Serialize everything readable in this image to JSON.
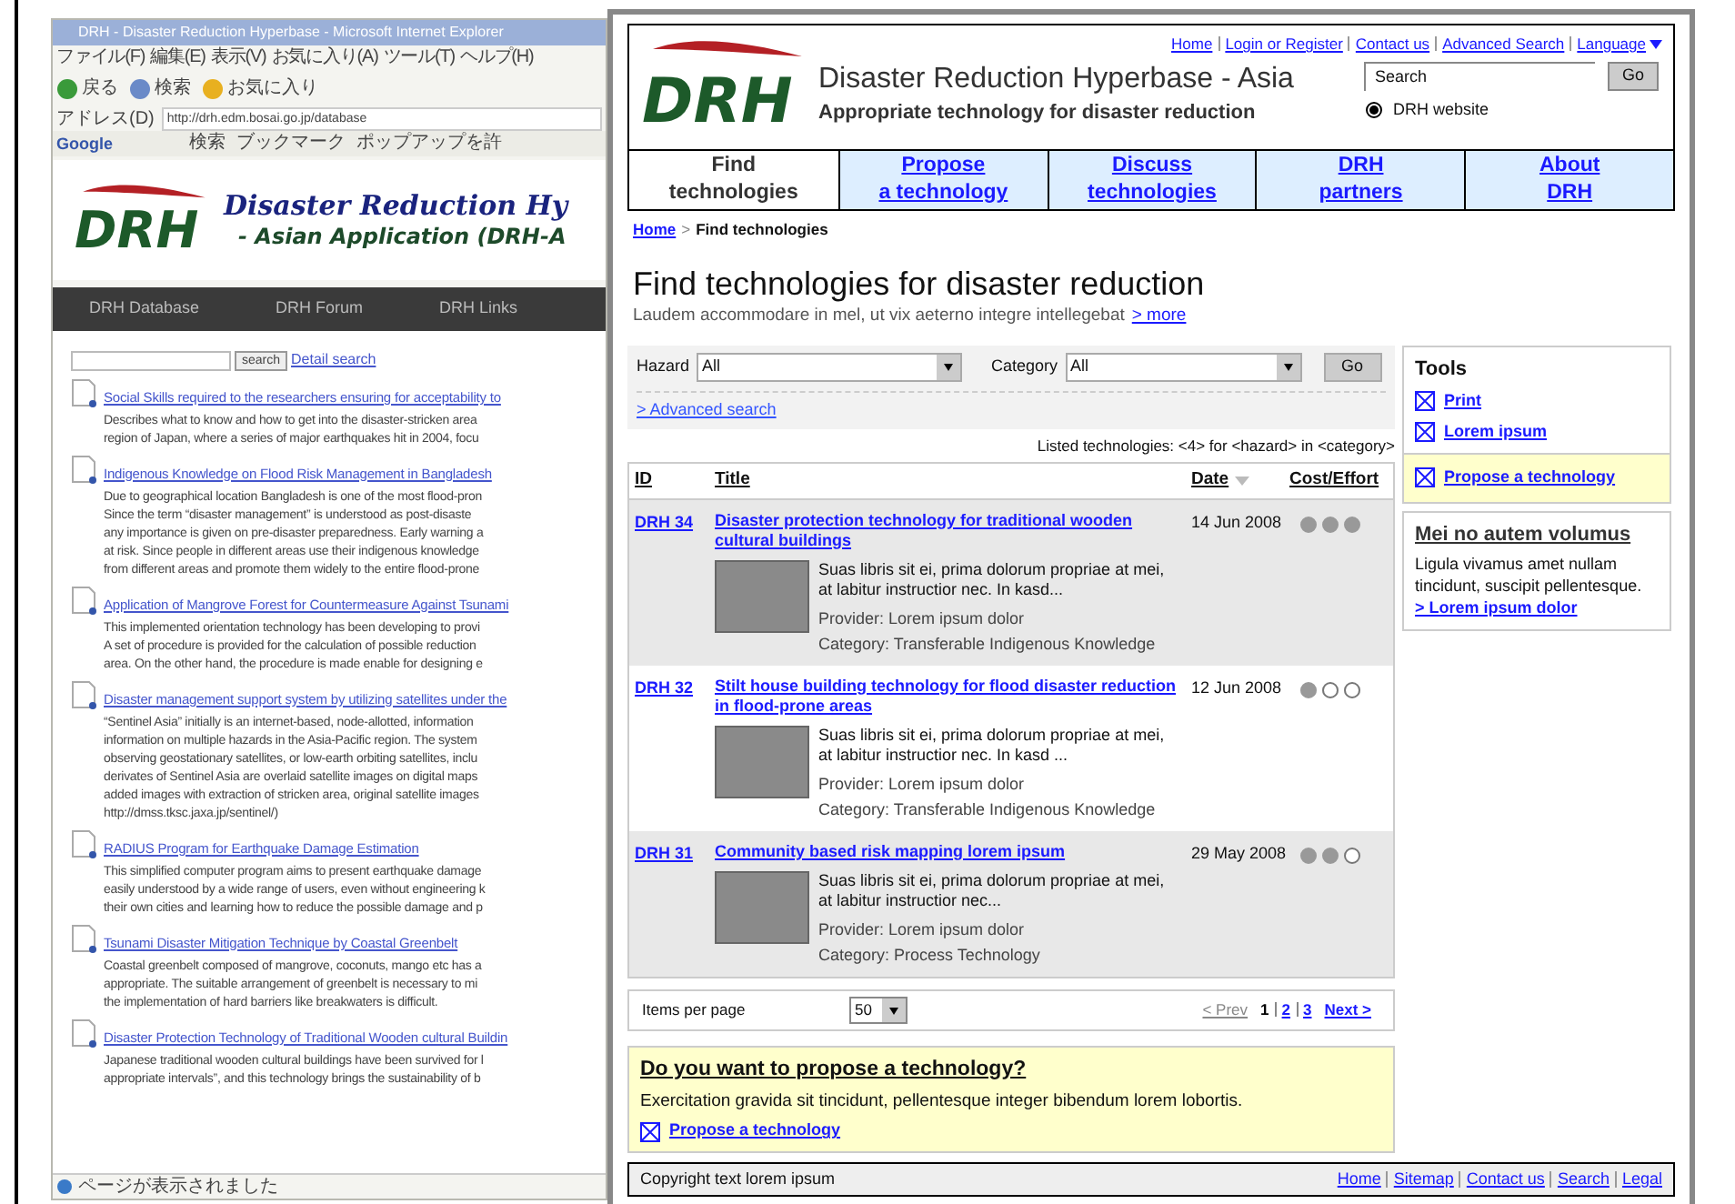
{
  "background_window": {
    "title": "DRH - Disaster Reduction Hyperbase - Microsoft Internet Explorer",
    "menu": [
      "ファイル(F)",
      "編集(E)",
      "表示(V)",
      "お気に入り(A)",
      "ツール(T)",
      "ヘルプ(H)"
    ],
    "toolbar": [
      "戻る",
      "検索",
      "お気に入り"
    ],
    "address_label": "アドレス(D)",
    "address": "http://drh.edm.bosai.go.jp/database",
    "google_bar": {
      "label": "Google",
      "items": [
        "検索",
        "ブックマーク",
        "ポップアップを許"
      ]
    },
    "banner": {
      "logo": "DRH",
      "title": "Disaster Reduction Hy",
      "subtitle": "- Asian Application (DRH-A"
    },
    "nav": [
      "DRH Database",
      "DRH Forum",
      "DRH Links"
    ],
    "search_button": "search",
    "detail_search": "Detail search",
    "entries": [
      {
        "title": "Social Skills required to the researchers ensuring for acceptability to",
        "lines": [
          "Describes what to know and how to get into the disaster-stricken area",
          "region of Japan, where a series of major earthquakes hit in 2004, focu"
        ]
      },
      {
        "title": "Indigenous Knowledge on Flood Risk Management in Bangladesh",
        "lines": [
          "Due to geographical location Bangladesh is one of the most flood-pron",
          "Since the term “disaster management” is understood as post-disaste",
          "any importance is given on pre-disaster preparedness. Early warning a",
          "at risk. Since people in different areas use their indigenous knowledge",
          "from different areas and promote them widely to the entire flood-prone"
        ]
      },
      {
        "title": "Application of Mangrove Forest for Countermeasure Against Tsunami",
        "lines": [
          "This implemented orientation technology has been developing to provi",
          "A set of procedure is provided for the calculation of possible reduction",
          "area. On the other hand, the procedure is made enable for designing e"
        ]
      },
      {
        "title": "Disaster management support system by utilizing satellites under the",
        "lines": [
          "“Sentinel Asia” initially is an internet-based, node-allotted, information",
          "information on multiple hazards in the Asia-Pacific region. The system",
          "observing geostationary satellites, or low-earth orbiting satellites, inclu",
          "derivates of Sentinel Asia are overlaid satellite images on digital maps",
          "added images with extraction of stricken area, original satellite images",
          "http://dmss.tksc.jaxa.jp/sentinel/)"
        ]
      },
      {
        "title": "RADIUS Program for Earthquake Damage Estimation",
        "lines": [
          "This simplified computer program aims to present earthquake damage",
          "easily understood by a wide range of users, even without engineering k",
          "their own cities and learning how to reduce the possible damage and p"
        ]
      },
      {
        "title": "Tsunami Disaster Mitigation Technique by Coastal Greenbelt",
        "lines": [
          "Coastal greenbelt composed of mangrove, coconuts, mango etc has a",
          "appropriate. The suitable arrangement of greenbelt is necessary to mi",
          "the implementation of hard barriers like breakwaters is difficult."
        ]
      },
      {
        "title": "Disaster Protection Technology of Traditional Wooden cultural Buildin",
        "lines": [
          "Japanese traditional wooden cultural buildings have been survived for l",
          "appropriate intervals”, and this technology brings the sustainability of b"
        ]
      }
    ],
    "status": "ページが表示されました"
  },
  "site": {
    "header_links": [
      "Home",
      "Login or Register",
      "Contact us",
      "Advanced Search",
      "Language"
    ],
    "logo": "DRH",
    "title": "Disaster Reduction Hyperbase - Asia",
    "subtitle": "Appropriate technology for disaster reduction",
    "search": {
      "value": "Search",
      "button": "Go",
      "scope": {
        "label": "DRH website",
        "selected": true
      }
    },
    "nav": [
      {
        "lines": [
          "Find",
          "technologies"
        ],
        "selected": true
      },
      {
        "lines": [
          "Propose",
          "a technology"
        ],
        "selected": false
      },
      {
        "lines": [
          "Discuss",
          "technologies"
        ],
        "selected": false
      },
      {
        "lines": [
          "DRH",
          "partners"
        ],
        "selected": false
      },
      {
        "lines": [
          "About",
          "DRH"
        ],
        "selected": false
      }
    ],
    "breadcrumb": {
      "link": "Home",
      "separator": ">",
      "current": "Find technologies"
    },
    "heading": "Find technologies for disaster reduction",
    "intro": "Laudem accommodare in mel, ut vix aeterno integre intellegebat",
    "more": "> more",
    "filters": {
      "hazard_label": "Hazard",
      "hazard": "All",
      "category_label": "Category",
      "category": "All",
      "button": "Go",
      "advanced": "> Advanced search"
    },
    "listed": "Listed technologies: <4> for <hazard> in <category>",
    "table": {
      "columns": [
        "ID",
        "Title",
        "Date",
        "Cost/Effort"
      ],
      "rows": [
        {
          "id": "DRH 34",
          "title": "Disaster protection technology for traditional wooden cultural buildings",
          "date": "14 Jun 2008",
          "cost_effort": [
            true,
            true,
            true
          ],
          "summary": "Suas libris sit ei, prima dolorum propriae at mei, at labitur instructior nec. In kasd...",
          "provider": "Provider: Lorem ipsum dolor",
          "category": "Category: Transferable Indigenous Knowledge",
          "shaded": true
        },
        {
          "id": "DRH 32",
          "title": "Stilt house building technology for flood disaster reduction in flood-prone areas",
          "date": "12 Jun 2008",
          "cost_effort": [
            true,
            false,
            false
          ],
          "summary": "Suas libris sit ei, prima dolorum propriae at mei, at labitur instructior nec. In kasd ...",
          "provider": "Provider: Lorem ipsum dolor",
          "category": "Category: Transferable Indigenous Knowledge",
          "shaded": false
        },
        {
          "id": "DRH 31",
          "title": "Community based risk mapping lorem ipsum",
          "date": "29 May 2008",
          "cost_effort": [
            true,
            true,
            false
          ],
          "summary": "Suas libris sit ei, prima dolorum propriae at mei, at labitur instructior nec...",
          "provider": "Provider: Lorem ipsum dolor",
          "category": "Category: Process Technology",
          "shaded": true
        }
      ]
    },
    "pagination": {
      "label": "Items per page",
      "per_page": "50",
      "prev": "< Prev",
      "prev_disabled": true,
      "pages": [
        {
          "label": "1",
          "selected": true
        },
        {
          "label": "2",
          "selected": false
        },
        {
          "label": "3",
          "selected": false
        }
      ],
      "next": "Next >"
    },
    "propose_box": {
      "title": "Do you want to propose a technology?",
      "text": "Exercitation gravida sit tincidunt, pellentesque integer bibendum lorem lobortis.",
      "link": "Propose a technology"
    },
    "tools": {
      "title": "Tools",
      "links": [
        "Print",
        "Lorem ipsum"
      ],
      "highlight_link": "Propose a technology"
    },
    "aside": {
      "title": "Mei no autem volumus",
      "text": "Ligula vivamus amet nullam tincidunt, suscipit pellentesque.",
      "link": "> Lorem ipsum dolor"
    },
    "footer": {
      "copyright": "Copyright text lorem ipsum",
      "links": [
        "Home",
        "Sitemap",
        "Contact us",
        "Search",
        "Legal"
      ]
    }
  }
}
